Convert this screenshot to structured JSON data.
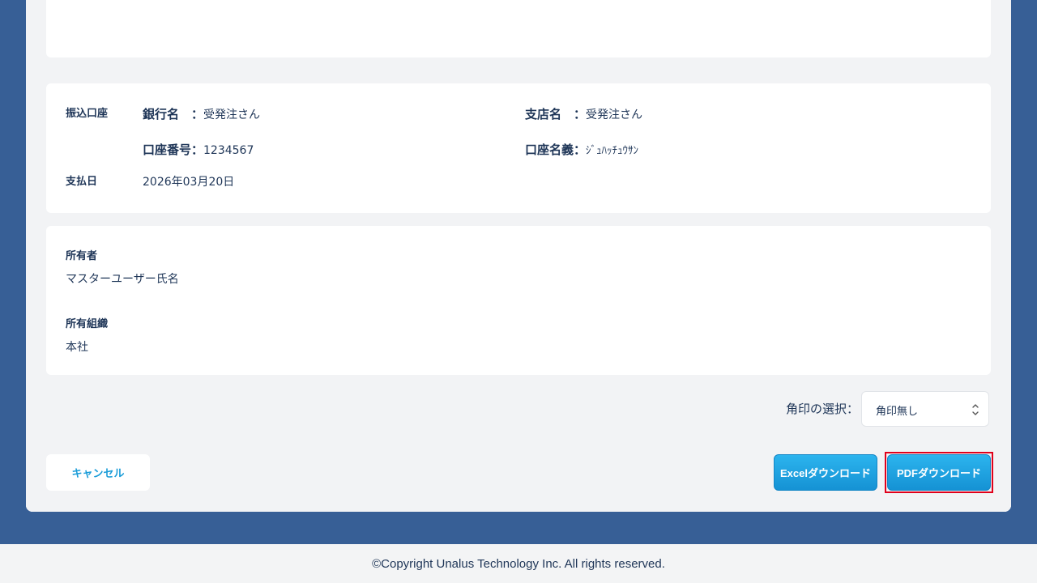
{
  "bank": {
    "section_label": "振込口座",
    "bank_name_label": "銀行名　：",
    "bank_name_value": "受発注さん",
    "branch_name_label": "支店名　：",
    "branch_name_value": "受発注さん",
    "account_number_label": "口座番号：",
    "account_number_value": "1234567",
    "account_holder_label": "口座名義：",
    "account_holder_value": "ｼﾞｭﾊｯﾁｭｳｻﾝ",
    "payment_date_label": "支払日",
    "payment_date_value": "2026年03月20日"
  },
  "owner": {
    "owner_label": "所有者",
    "owner_value": "マスターユーザー氏名",
    "org_label": "所有組織",
    "org_value": "本社"
  },
  "stamp": {
    "label": "角印の選択：",
    "selected": "角印無し"
  },
  "actions": {
    "cancel": "キャンセル",
    "excel_download": "Excelダウンロード",
    "pdf_download": "PDFダウンロード"
  },
  "footer": {
    "copyright": "©Copyright Unalus Technology Inc. All rights reserved."
  },
  "colors": {
    "page_background": "#375f96",
    "accent": "#1a9cd8",
    "text": "#1e3557",
    "highlight": "#e0001b"
  }
}
